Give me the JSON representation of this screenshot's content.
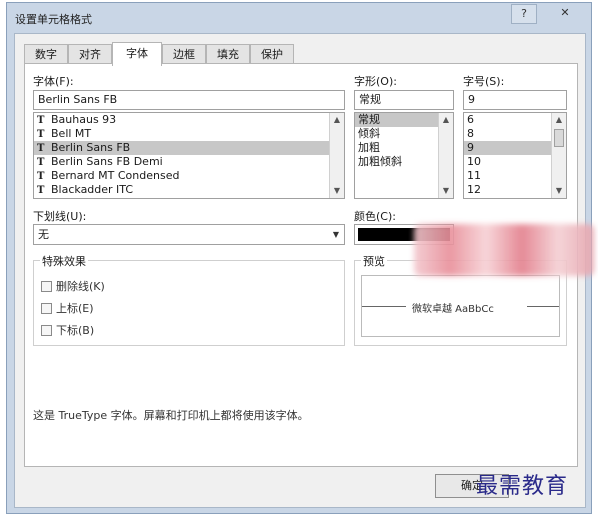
{
  "dialog": {
    "title": "设置单元格格式",
    "help_label": "?",
    "close_label": "✕"
  },
  "tabs": [
    {
      "label": "数字"
    },
    {
      "label": "对齐"
    },
    {
      "label": "字体"
    },
    {
      "label": "边框"
    },
    {
      "label": "填充"
    },
    {
      "label": "保护"
    }
  ],
  "font": {
    "label": "字体(F):",
    "value": "Berlin Sans FB",
    "list": [
      "Bauhaus 93",
      "Bell MT",
      "Berlin Sans FB",
      "Berlin Sans FB Demi",
      "Bernard MT Condensed",
      "Blackadder ITC"
    ],
    "selected": "Berlin Sans FB"
  },
  "style": {
    "label": "字形(O):",
    "value": "常规",
    "list": [
      "常规",
      "倾斜",
      "加粗",
      "加粗倾斜"
    ],
    "selected": "常规"
  },
  "size": {
    "label": "字号(S):",
    "value": "9",
    "list": [
      "6",
      "8",
      "9",
      "10",
      "11",
      "12"
    ],
    "selected": "9"
  },
  "underline": {
    "label": "下划线(U):",
    "value": "无"
  },
  "color": {
    "label": "颜色(C):",
    "value_hex": "#000000"
  },
  "effects": {
    "title": "特殊效果",
    "items": [
      {
        "label": "删除线(K)"
      },
      {
        "label": "上标(E)"
      },
      {
        "label": "下标(B)"
      }
    ]
  },
  "preview": {
    "title": "预览",
    "sample": "微软卓越 AaBbCc"
  },
  "note": "这是 TrueType 字体。屏幕和打印机上都将使用该字体。",
  "buttons": {
    "ok": "确定"
  },
  "watermark": "最需教育"
}
